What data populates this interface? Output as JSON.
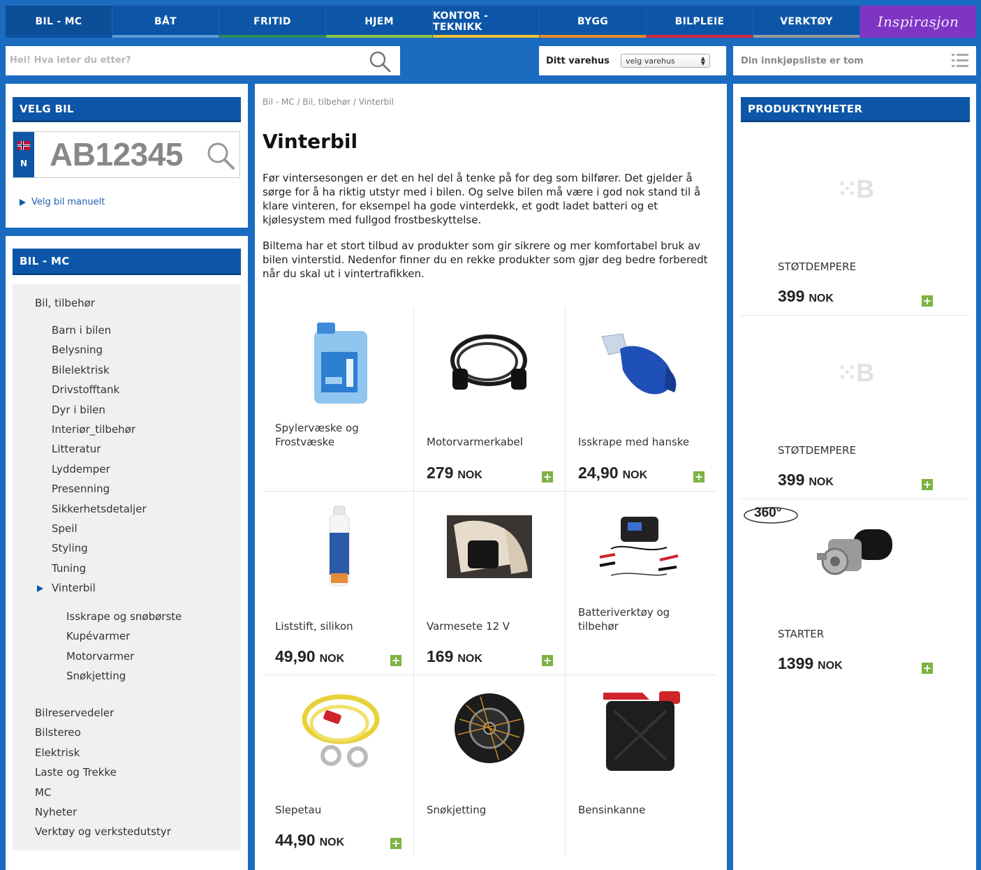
{
  "nav": {
    "items": [
      {
        "label": "BIL - MC",
        "color": "#0d56a7"
      },
      {
        "label": "BÅT",
        "color": "#5b9bd5"
      },
      {
        "label": "FRITID",
        "color": "#2e8b57"
      },
      {
        "label": "HJEM",
        "color": "#8cc63f"
      },
      {
        "label": "KONTOR - TEKNIKK",
        "color": "#f2c12e"
      },
      {
        "label": "BYGG",
        "color": "#f08a24"
      },
      {
        "label": "BILPLEIE",
        "color": "#d9263a"
      },
      {
        "label": "VERKTØY",
        "color": "#9a9a9a"
      }
    ],
    "inspiration": "Inspirasjon"
  },
  "search": {
    "placeholder": "Hei! Hva leter du etter?"
  },
  "store": {
    "label": "Ditt varehus",
    "select_value": "velg varehus"
  },
  "cart": {
    "label": "Din innkjøpsliste er tom"
  },
  "velg_bil": {
    "title": "VELG BIL",
    "plate_country": "N",
    "plate_number": "AB12345",
    "manual_link": "Velg bil manuelt"
  },
  "category": {
    "title": "BIL - MC",
    "parent": "Bil, tilbehør",
    "children": [
      "Barn i bilen",
      "Belysning",
      "Bilelektrisk",
      "Drivstofftank",
      "Dyr i bilen",
      "Interiør_tilbehør",
      "Litteratur",
      "Lyddemper",
      "Presenning",
      "Sikkerhetsdetaljer",
      "Speil",
      "Styling",
      "Tuning",
      "Vinterbil"
    ],
    "sub_children": [
      "Isskrape og snøbørste",
      "Kupévarmer",
      "Motorvarmer",
      "Snøkjetting"
    ],
    "siblings": [
      "Bilreservedeler",
      "Bilstereo",
      "Elektrisk",
      "Laste og Trekke",
      "MC",
      "Nyheter",
      "Verktøy og verkstedutstyr"
    ]
  },
  "main": {
    "breadcrumb": "Bil - MC / Bil, tilbehør / Vinterbil",
    "title": "Vinterbil",
    "intro1": "Før vintersesongen er det en hel del å tenke på for deg som bilfører. Det gjelder å sørge for å ha riktig utstyr med i bilen. Og selve bilen må være i god nok stand til å klare vinteren, for eksempel ha gode vinterdekk, et godt ladet batteri og et kjølesystem med fullgod frostbeskyttelse.",
    "intro2": "Biltema har et stort tilbud av produkter som gir sikrere og mer komfortabel bruk av bilen vinterstid. Nedenfor finner du en rekke produkter som gjør deg bedre forberedt når du skal ut i vintertrafikken.",
    "products": [
      {
        "name": "Spylervæske og Frostvæske",
        "price": "",
        "currency": "",
        "icon": "washer-fluid-can"
      },
      {
        "name": "Motorvarmerkabel",
        "price": "279",
        "currency": "NOK",
        "icon": "engine-heater-cable"
      },
      {
        "name": "Isskrape med hanske",
        "price": "24,90",
        "currency": "NOK",
        "icon": "ice-scraper-glove"
      },
      {
        "name": "Liststift, silikon",
        "price": "49,90",
        "currency": "NOK",
        "icon": "silicone-stick"
      },
      {
        "name": "Varmesete 12 V",
        "price": "169",
        "currency": "NOK",
        "icon": "heated-seat"
      },
      {
        "name": "Batteriverktøy og tilbehør",
        "price": "",
        "currency": "",
        "icon": "battery-charger"
      },
      {
        "name": "Slepetau",
        "price": "44,90",
        "currency": "NOK",
        "icon": "tow-rope"
      },
      {
        "name": "Snøkjetting",
        "price": "",
        "currency": "",
        "icon": "snow-chain"
      },
      {
        "name": "Bensinkanne",
        "price": "",
        "currency": "",
        "icon": "fuel-can"
      }
    ]
  },
  "news": {
    "title": "PRODUKTNYHETER",
    "badge_360": "360°",
    "items": [
      {
        "name": "STØTDEMPERE",
        "price": "399",
        "currency": "NOK",
        "icon": "biltema-placeholder"
      },
      {
        "name": "STØTDEMPERE",
        "price": "399",
        "currency": "NOK",
        "icon": "biltema-placeholder"
      },
      {
        "name": "STARTER",
        "price": "1399",
        "currency": "NOK",
        "icon": "starter-motor"
      }
    ]
  },
  "colors": {
    "brand_blue": "#0d56a7",
    "page_blue": "#1b6bc0",
    "add_green": "#7cb342",
    "inspiration_purple": "#7f35c3"
  }
}
